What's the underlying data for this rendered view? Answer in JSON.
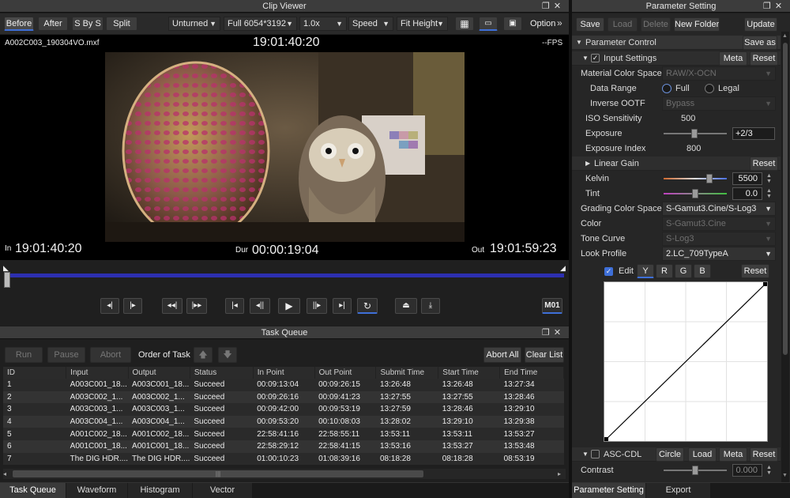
{
  "clip_viewer": {
    "title": "Clip Viewer",
    "compare_buttons": [
      "Before",
      "After",
      "S By S",
      "Split"
    ],
    "dropdowns": {
      "unturned": "Unturned",
      "full": "Full 6054*3192",
      "zoom": "1.0x",
      "speed": "Speed",
      "fit": "Fit Height"
    },
    "option_label": "Option",
    "filename": "A002C003_190304VO.mxf",
    "timecode_top": "19:01:40:20",
    "fps": "--FPS",
    "in_label": "In",
    "in_tc": "19:01:40:20",
    "dur_label": "Dur",
    "dur_tc": "00:00:19:04",
    "out_label": "Out",
    "out_tc": "19:01:59:23",
    "m01_label": "M01"
  },
  "task_queue": {
    "title": "Task Queue",
    "buttons": {
      "run": "Run",
      "pause": "Pause",
      "abort": "Abort",
      "order": "Order of Task",
      "abort_all": "Abort All",
      "clear_list": "Clear List"
    },
    "columns": [
      "ID",
      "Input",
      "Output",
      "Status",
      "In Point",
      "Out Point",
      "Submit Time",
      "Start Time",
      "End Time"
    ],
    "rows": [
      [
        "1",
        "A003C001_18...",
        "A003C001_18...",
        "Succeed",
        "00:09:13:04",
        "00:09:26:15",
        "13:26:48",
        "13:26:48",
        "13:27:34"
      ],
      [
        "2",
        "A003C002_1...",
        "A003C002_1...",
        "Succeed",
        "00:09:26:16",
        "00:09:41:23",
        "13:27:55",
        "13:27:55",
        "13:28:46"
      ],
      [
        "3",
        "A003C003_1...",
        "A003C003_1...",
        "Succeed",
        "00:09:42:00",
        "00:09:53:19",
        "13:27:59",
        "13:28:46",
        "13:29:10"
      ],
      [
        "4",
        "A003C004_1...",
        "A003C004_1...",
        "Succeed",
        "00:09:53:20",
        "00:10:08:03",
        "13:28:02",
        "13:29:10",
        "13:29:38"
      ],
      [
        "5",
        "A001C002_18...",
        "A001C002_18...",
        "Succeed",
        "22:58:41:16",
        "22:58:55:11",
        "13:53:11",
        "13:53:11",
        "13:53:27"
      ],
      [
        "6",
        "A001C001_18...",
        "A001C001_18...",
        "Succeed",
        "22:58:29:12",
        "22:58:41:15",
        "13:53:16",
        "13:53:27",
        "13:53:48"
      ],
      [
        "7",
        "The DIG HDR....",
        "The DIG HDR....",
        "Succeed",
        "01:00:10:23",
        "01:08:39:16",
        "08:18:28",
        "08:18:28",
        "08:53:19"
      ]
    ],
    "scroll_grip": "|||"
  },
  "bottom_tabs": [
    "Task Queue",
    "Waveform",
    "Histogram",
    "Vector"
  ],
  "parameter_setting": {
    "title": "Parameter Setting",
    "top_buttons": {
      "save": "Save",
      "load": "Load",
      "delete": "Delete",
      "new_folder": "New Folder",
      "update": "Update"
    },
    "parameter_control": "Parameter Control",
    "save_as": "Save as",
    "input_settings": "Input Settings",
    "meta": "Meta",
    "reset": "Reset",
    "material_color_space": {
      "label": "Material Color Space",
      "value": "RAW/X-OCN"
    },
    "data_range": {
      "label": "Data Range",
      "full": "Full",
      "legal": "Legal"
    },
    "inverse_ootf": {
      "label": "Inverse OOTF",
      "value": "Bypass"
    },
    "iso": {
      "label": "ISO Sensitivity",
      "value": "500"
    },
    "exposure": {
      "label": "Exposure",
      "value": "+2/3"
    },
    "exposure_index": {
      "label": "Exposure Index",
      "value": "800"
    },
    "linear_gain": "Linear Gain",
    "kelvin": {
      "label": "Kelvin",
      "value": "5500"
    },
    "tint": {
      "label": "Tint",
      "value": "0.0"
    },
    "grading_color_space": {
      "label": "Grading Color Space",
      "value": "S-Gamut3.Cine/S-Log3"
    },
    "color": {
      "label": "Color",
      "value": "S-Gamut3.Cine"
    },
    "tone_curve": {
      "label": "Tone Curve",
      "value": "S-Log3"
    },
    "look_profile": {
      "label": "Look Profile",
      "value": "2.LC_709TypeA"
    },
    "edit_label": "Edit",
    "channels": [
      "Y",
      "R",
      "G",
      "B"
    ],
    "asc_cdl": "ASC-CDL",
    "asc_buttons": {
      "circle": "Circle",
      "load": "Load",
      "meta": "Meta",
      "reset": "Reset"
    },
    "contrast": {
      "label": "Contrast",
      "value": "0.000"
    }
  },
  "right_tabs": [
    "Parameter Setting",
    "Export"
  ],
  "colors": {
    "accent": "#3e6fd8",
    "timeline": "#2d2fb0",
    "panel": "#1e1e1e"
  }
}
